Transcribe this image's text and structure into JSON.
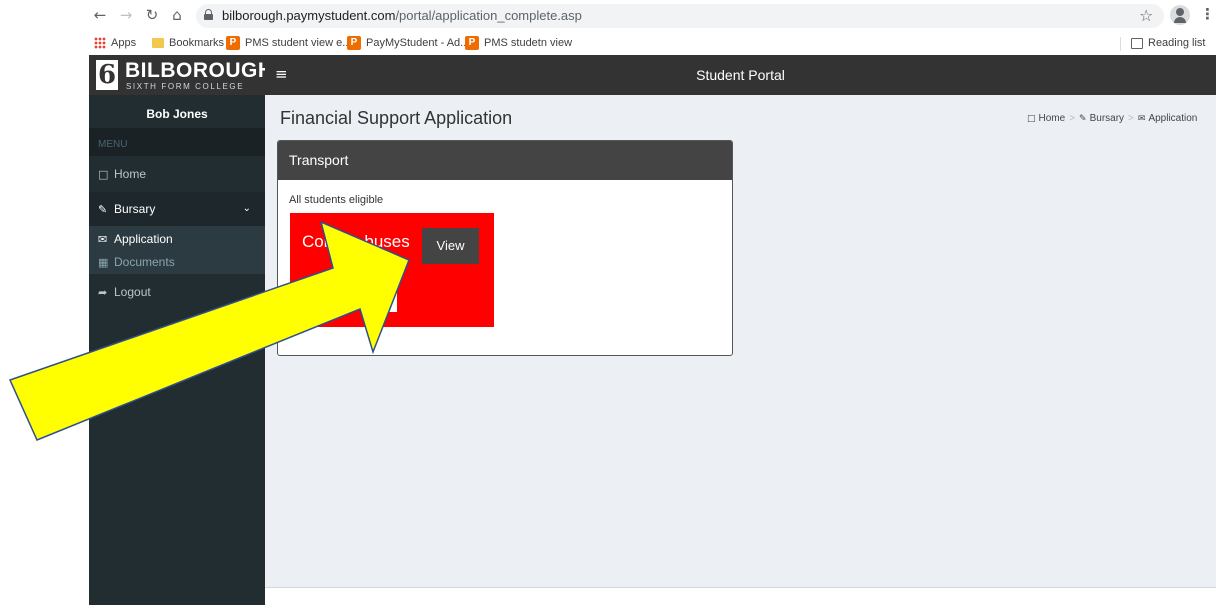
{
  "browser": {
    "url_host": "bilborough.paymystudent.com",
    "url_path": "/portal/application_complete.asp",
    "bookmarks": [
      "Apps",
      "Bookmarks",
      "PMS student view e...",
      "PayMyStudent - Ad...",
      "PMS studetn view"
    ],
    "reading_list": "Reading list"
  },
  "brand": {
    "logo_glyph": "6",
    "name": "BILBOROUGH",
    "subtitle": "SIXTH FORM COLLEGE"
  },
  "header": {
    "title": "Student Portal"
  },
  "sidebar": {
    "user_name": "Bob Jones",
    "menu_header": "MENU",
    "items": [
      {
        "label": "Home",
        "icon": "laptop-icon"
      },
      {
        "label": "Bursary",
        "icon": "edit-icon"
      },
      {
        "label": "Logout",
        "icon": "share-icon"
      }
    ],
    "submenu": [
      {
        "label": "Application",
        "icon": "envelope-icon"
      },
      {
        "label": "Documents",
        "icon": "pdf-file-icon"
      }
    ]
  },
  "main": {
    "page_title": "Financial Support Application",
    "breadcrumb": [
      "Home",
      "Bursary",
      "Application"
    ],
    "box": {
      "title": "Transport",
      "description": "All students eligible",
      "tile": {
        "title": "College buses",
        "view_label": "View"
      }
    }
  },
  "colors": {
    "sidebar": "#222d32",
    "topbar": "#333333",
    "content_bg": "#ecf0f5",
    "tile": "#ff0000",
    "arrow_fill": "#ffff00",
    "arrow_stroke": "#2f4f8f"
  }
}
